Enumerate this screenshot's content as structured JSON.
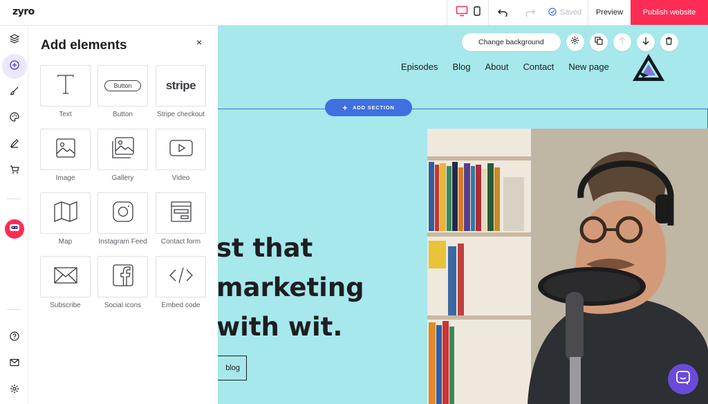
{
  "app": {
    "logo": "zyro"
  },
  "topbar": {
    "saved_label": "Saved",
    "preview_label": "Preview",
    "publish_label": "Publish website"
  },
  "rail": {
    "icons": [
      "layers-icon",
      "add-element-icon",
      "brush-icon",
      "palette-icon",
      "pen-icon",
      "cart-icon",
      "robot-icon",
      "help-icon",
      "mail-icon",
      "settings-icon"
    ]
  },
  "panel": {
    "title": "Add elements",
    "close": "×",
    "elements": [
      {
        "label": "Text",
        "icon": "text-icon"
      },
      {
        "label": "Button",
        "icon": "button-icon",
        "inner": "Button"
      },
      {
        "label": "Stripe checkout",
        "icon": "stripe-icon",
        "inner": "stripe"
      },
      {
        "label": "Image",
        "icon": "image-icon"
      },
      {
        "label": "Gallery",
        "icon": "gallery-icon"
      },
      {
        "label": "Video",
        "icon": "video-icon"
      },
      {
        "label": "Map",
        "icon": "map-icon"
      },
      {
        "label": "Instagram Feed",
        "icon": "instagram-icon"
      },
      {
        "label": "Contact form",
        "icon": "form-icon"
      },
      {
        "label": "Subscribe",
        "icon": "envelope-icon"
      },
      {
        "label": "Social icons",
        "icon": "facebook-icon"
      },
      {
        "label": "Embed code",
        "icon": "code-icon"
      }
    ]
  },
  "canvas": {
    "change_background": "Change background",
    "add_section": "ADD SECTION",
    "nav": [
      "Episodes",
      "Blog",
      "About",
      "Contact",
      "New page"
    ],
    "headline": [
      "st that",
      "marketing",
      "with wit."
    ],
    "cta": "blog",
    "bg_color": "#a6e8ec"
  },
  "colors": {
    "accent": "#3f6fe0",
    "publish": "#fe2c55",
    "chat": "#6a4bd9"
  }
}
